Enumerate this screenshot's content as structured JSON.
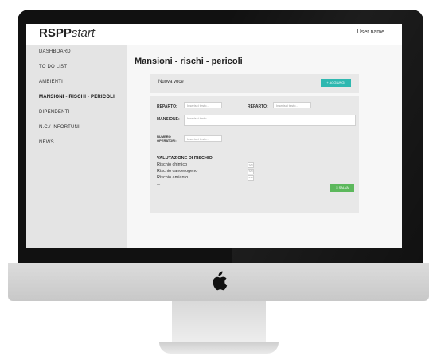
{
  "app": {
    "brand_bold": "RSPP",
    "brand_italic": "start",
    "user_label": "User name"
  },
  "sidebar": {
    "items": [
      {
        "label": "DASHBOARD",
        "active": false
      },
      {
        "label": "TO DO LIST",
        "active": false
      },
      {
        "label": "AMBIENTI",
        "active": false
      },
      {
        "label": "MANSIONI - RISCHI - PERICOLI",
        "active": true
      },
      {
        "label": "DIPENDENTI",
        "active": false
      },
      {
        "label": "N.C./ INFORTUNI",
        "active": false
      },
      {
        "label": "NEWS",
        "active": false
      }
    ]
  },
  "main": {
    "title": "Mansioni - rischi - pericoli",
    "new_entry_label": "Nuova voce",
    "add_button": "AGGIUNGI",
    "form": {
      "reparto_label_1": "REPARTO:",
      "reparto_label_2": "REPARTO:",
      "mansione_label": "MANSIONE:",
      "numero_label_line1": "NUMERO",
      "numero_label_line2": "OPERATORI:",
      "placeholder": "Inserisci testo..."
    },
    "valutazione": {
      "title": "VALUTAZIONE DI RISCHIO",
      "risks": [
        "Rischio chimico",
        "Rischio cancerogeno",
        "Rischio amianto",
        "..."
      ],
      "checkbox_text": "S/N"
    },
    "save_button": "SALVA"
  },
  "colors": {
    "accent_add": "#2eb8b0",
    "accent_save": "#5cb85c"
  }
}
